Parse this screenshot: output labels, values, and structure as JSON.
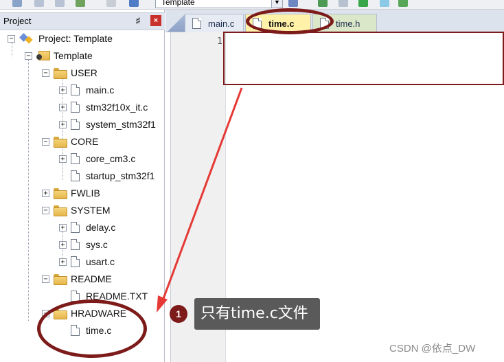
{
  "toolbar": {
    "target_select_value": "Template"
  },
  "project_panel": {
    "title": "Project",
    "pin_glyph": "♯",
    "close_glyph": "×",
    "tree": {
      "project_label": "Project: Template",
      "target_label": "Template",
      "groups": [
        {
          "label": "USER",
          "files": [
            "main.c",
            "stm32f10x_it.c",
            "system_stm32f1"
          ]
        },
        {
          "label": "CORE",
          "files": [
            "core_cm3.c",
            "startup_stm32f1"
          ]
        },
        {
          "label": "FWLIB",
          "files": []
        },
        {
          "label": "SYSTEM",
          "files": [
            "delay.c",
            "sys.c",
            "usart.c"
          ]
        },
        {
          "label": "README",
          "files": [
            "README.TXT"
          ]
        },
        {
          "label": "HRADWARE",
          "files": [
            "time.c"
          ]
        }
      ]
    }
  },
  "editor": {
    "tabs": [
      {
        "label": "main.c",
        "active": false
      },
      {
        "label": "time.c",
        "active": true
      },
      {
        "label": "time.h",
        "active": false
      }
    ],
    "line_numbers": [
      "1"
    ]
  },
  "annotation": {
    "step_number": "1",
    "callout_text": "只有time.c文件",
    "color": "#7d1a1a"
  },
  "watermark": "CSDN @依点_DW"
}
